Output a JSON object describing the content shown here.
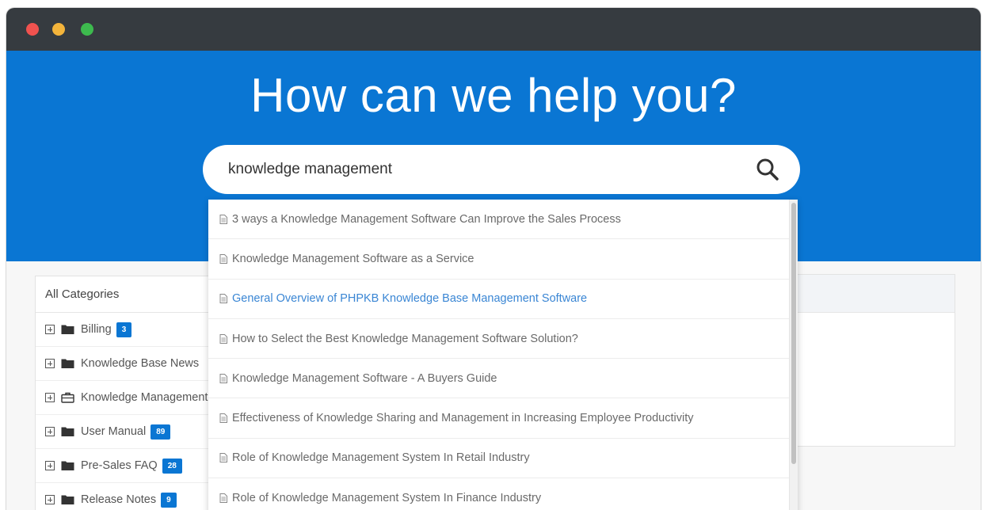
{
  "hero": {
    "title": "How can we help you?"
  },
  "search": {
    "value": "knowledge management",
    "icon": "search-icon"
  },
  "suggestions": [
    {
      "text": "3 ways a Knowledge Management Software Can Improve the Sales Process",
      "active": false
    },
    {
      "text": "Knowledge Management Software as a Service",
      "active": false
    },
    {
      "text": "General Overview of PHPKB Knowledge Base Management Software",
      "active": true
    },
    {
      "text": "How to Select the Best Knowledge Management Software Solution?",
      "active": false
    },
    {
      "text": "Knowledge Management Software - A Buyers Guide",
      "active": false
    },
    {
      "text": "Effectiveness of Knowledge Sharing and Management in Increasing Employee Productivity",
      "active": false
    },
    {
      "text": "Role of Knowledge Management System In Retail Industry",
      "active": false
    },
    {
      "text": "Role of Knowledge Management System In Finance Industry",
      "active": false
    }
  ],
  "categories": {
    "header": "All Categories",
    "items": [
      {
        "label": "Billing",
        "count": "3",
        "icon": "folder-icon"
      },
      {
        "label": "Knowledge Base News",
        "count": "",
        "icon": "folder-icon"
      },
      {
        "label": "Knowledge Management",
        "count": "",
        "icon": "briefcase-icon"
      },
      {
        "label": "User Manual",
        "count": "89",
        "icon": "folder-icon"
      },
      {
        "label": "Pre-Sales FAQ",
        "count": "28",
        "icon": "folder-icon"
      },
      {
        "label": "Release Notes",
        "count": "9",
        "icon": "folder-icon"
      }
    ]
  },
  "colors": {
    "accent": "#0a76d3",
    "titlebar": "#363b40",
    "link_active": "#3a86d4"
  }
}
